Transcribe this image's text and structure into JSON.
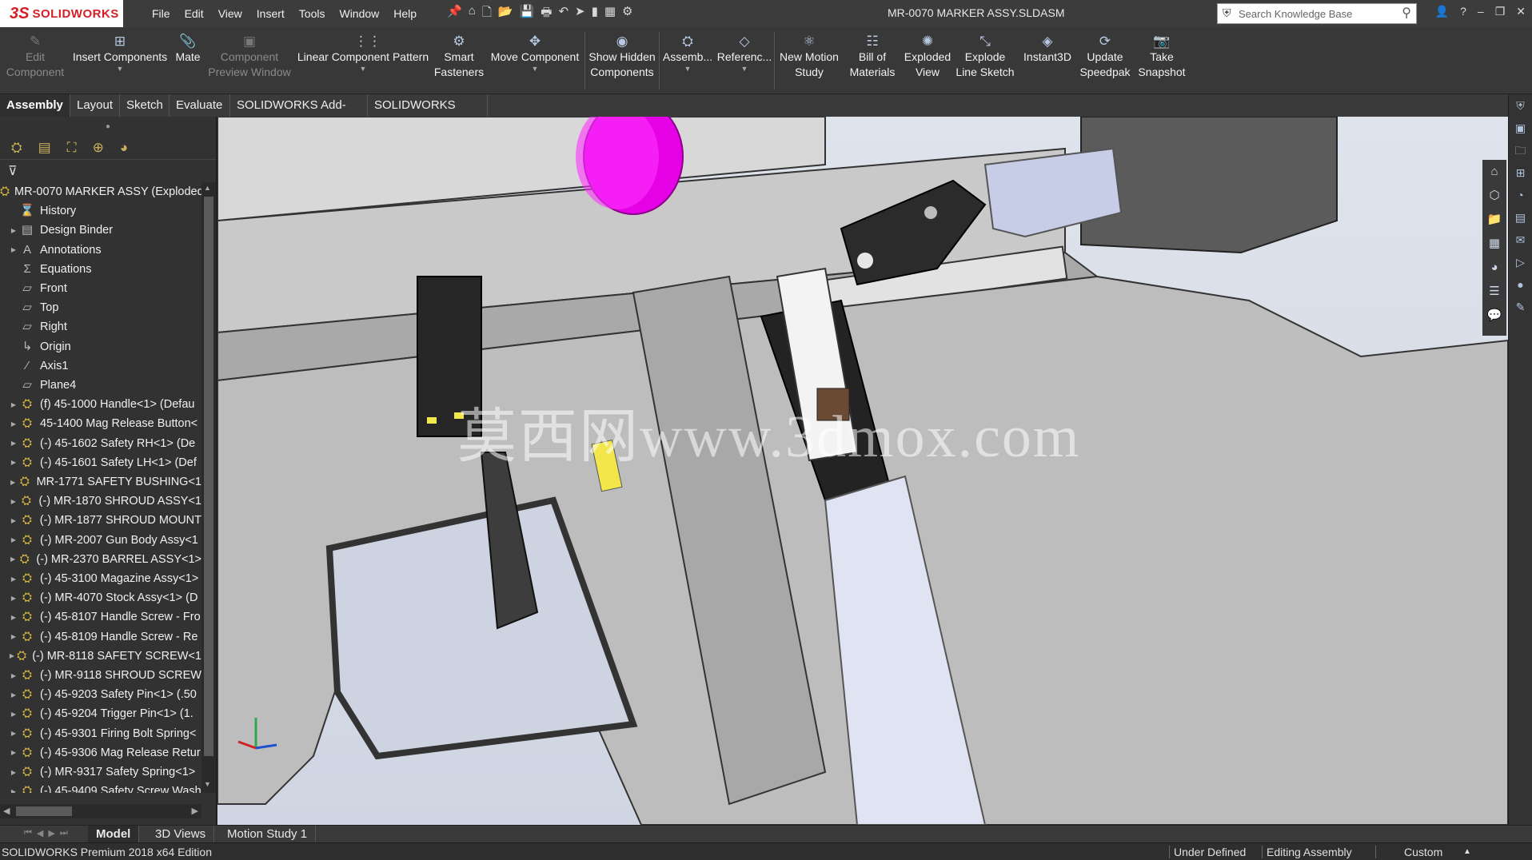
{
  "app": {
    "logo_ds": "3S",
    "logo_text": "SOLIDWORKS",
    "document_title": "MR-0070 MARKER ASSY.SLDASM"
  },
  "menu": [
    "File",
    "Edit",
    "View",
    "Insert",
    "Tools",
    "Window",
    "Help"
  ],
  "search": {
    "placeholder": "Search Knowledge Base"
  },
  "commands": [
    {
      "id": "edit-component",
      "label": "Edit Component",
      "icon": "edit-component-icon",
      "enabled": false
    },
    {
      "id": "insert-components",
      "label": "Insert Components",
      "icon": "insert-components-icon",
      "enabled": true
    },
    {
      "id": "mate",
      "label": "Mate",
      "icon": "mate-icon",
      "enabled": true
    },
    {
      "id": "component-preview-window",
      "label": "Component Preview Window",
      "icon": "preview-window-icon",
      "enabled": false
    },
    {
      "id": "linear-component-pattern",
      "label": "Linear Component Pattern",
      "icon": "linear-pattern-icon",
      "enabled": true
    },
    {
      "id": "smart-fasteners",
      "label": "Smart Fasteners",
      "icon": "smart-fasteners-icon",
      "enabled": true
    },
    {
      "id": "move-component",
      "label": "Move Component",
      "icon": "move-component-icon",
      "enabled": true
    },
    {
      "id": "show-hidden-components",
      "label": "Show Hidden Components",
      "icon": "show-hidden-icon",
      "enabled": true
    },
    {
      "id": "assembly-features",
      "label": "Assemb...",
      "icon": "assembly-features-icon",
      "enabled": true
    },
    {
      "id": "reference-geometry",
      "label": "Referenc...",
      "icon": "reference-geometry-icon",
      "enabled": true
    },
    {
      "id": "new-motion-study",
      "label": "New Motion Study",
      "icon": "motion-study-icon",
      "enabled": true
    },
    {
      "id": "bill-of-materials",
      "label": "Bill of Materials",
      "icon": "bill-of-materials-icon",
      "enabled": true
    },
    {
      "id": "exploded-view",
      "label": "Exploded View",
      "icon": "exploded-view-icon",
      "enabled": true
    },
    {
      "id": "explode-line-sketch",
      "label": "Explode Line Sketch",
      "icon": "explode-line-icon",
      "enabled": true
    },
    {
      "id": "instant3d",
      "label": "Instant3D",
      "icon": "instant3d-icon",
      "enabled": true
    },
    {
      "id": "update-speedpak",
      "label": "Update Speedpak",
      "icon": "speedpak-icon",
      "enabled": true
    },
    {
      "id": "take-snapshot",
      "label": "Take Snapshot",
      "icon": "camera-icon",
      "enabled": true
    }
  ],
  "tabs": [
    "Assembly",
    "Layout",
    "Sketch",
    "Evaluate",
    "SOLIDWORKS Add-Ins",
    "SOLIDWORKS MBD"
  ],
  "active_tab": "Assembly",
  "tree": [
    {
      "label": "MR-0070 MARKER ASSY (Exploded",
      "icon": "assembly-icon",
      "expander": false,
      "indent": 0
    },
    {
      "label": "History",
      "icon": "history-icon",
      "expander": false,
      "indent": 1
    },
    {
      "label": "Design Binder",
      "icon": "design-binder-icon",
      "expander": true,
      "indent": 1
    },
    {
      "label": "Annotations",
      "icon": "annotations-icon",
      "expander": true,
      "indent": 1
    },
    {
      "label": "Equations",
      "icon": "equations-icon",
      "expander": false,
      "indent": 1
    },
    {
      "label": "Front",
      "icon": "plane-icon",
      "expander": false,
      "indent": 1
    },
    {
      "label": "Top",
      "icon": "plane-icon",
      "expander": false,
      "indent": 1
    },
    {
      "label": "Right",
      "icon": "plane-icon",
      "expander": false,
      "indent": 1
    },
    {
      "label": "Origin",
      "icon": "origin-icon",
      "expander": false,
      "indent": 1
    },
    {
      "label": "Axis1",
      "icon": "axis-icon",
      "expander": false,
      "indent": 1
    },
    {
      "label": "Plane4",
      "icon": "plane-icon",
      "expander": false,
      "indent": 1
    },
    {
      "label": "(f) 45-1000 Handle<1> (Defau",
      "icon": "part-icon",
      "expander": true,
      "indent": 1
    },
    {
      "label": "45-1400 Mag Release Button<",
      "icon": "subassembly-icon",
      "expander": true,
      "indent": 1
    },
    {
      "label": "(-) 45-1602 Safety RH<1> (De",
      "icon": "part-icon",
      "expander": true,
      "indent": 1
    },
    {
      "label": "(-) 45-1601 Safety LH<1> (Def",
      "icon": "part-icon",
      "expander": true,
      "indent": 1
    },
    {
      "label": "MR-1771 SAFETY BUSHING<1",
      "icon": "part-icon",
      "expander": true,
      "indent": 1
    },
    {
      "label": "(-) MR-1870 SHROUD ASSY<1",
      "icon": "subassembly-icon",
      "expander": true,
      "indent": 1
    },
    {
      "label": "(-) MR-1877 SHROUD MOUNT",
      "icon": "part-icon",
      "expander": true,
      "indent": 1
    },
    {
      "label": "(-) MR-2007 Gun Body Assy<1",
      "icon": "subassembly-icon",
      "expander": true,
      "indent": 1
    },
    {
      "label": "(-) MR-2370 BARREL ASSY<1>",
      "icon": "subassembly-icon",
      "expander": true,
      "indent": 1
    },
    {
      "label": "(-) 45-3100 Magazine Assy<1>",
      "icon": "subassembly-icon",
      "expander": true,
      "indent": 1
    },
    {
      "label": "(-) MR-4070 Stock Assy<1> (D",
      "icon": "subassembly-icon",
      "expander": true,
      "indent": 1
    },
    {
      "label": "(-) 45-8107 Handle Screw - Fro",
      "icon": "part-icon",
      "expander": true,
      "indent": 1
    },
    {
      "label": "(-) 45-8109 Handle Screw - Re",
      "icon": "part-icon",
      "expander": true,
      "indent": 1
    },
    {
      "label": "(-) MR-8118 SAFETY SCREW<1",
      "icon": "part-icon",
      "expander": true,
      "indent": 1
    },
    {
      "label": "(-) MR-9118 SHROUD SCREW",
      "icon": "part-icon",
      "expander": true,
      "indent": 1
    },
    {
      "label": "(-) 45-9203 Safety Pin<1> (.50",
      "icon": "part-icon",
      "expander": true,
      "indent": 1
    },
    {
      "label": "(-) 45-9204 Trigger Pin<1> (1.",
      "icon": "part-icon",
      "expander": true,
      "indent": 1
    },
    {
      "label": "(-) 45-9301 Firing Bolt Spring<",
      "icon": "part-icon",
      "expander": true,
      "indent": 1
    },
    {
      "label": "(-) 45-9306 Mag Release Retur",
      "icon": "part-icon",
      "expander": true,
      "indent": 1
    },
    {
      "label": "(-) MR-9317 Safety Spring<1>",
      "icon": "part-icon",
      "expander": true,
      "indent": 1
    },
    {
      "label": "(-) 45-9409 Safety Screw Wash",
      "icon": "part-icon",
      "expander": true,
      "indent": 1
    }
  ],
  "watermark": "莫西网www.3dmox.com",
  "bottom_tabs": [
    "Model",
    "3D Views",
    "Motion Study 1"
  ],
  "active_bottom_tab": "Model",
  "status": {
    "edition": "SOLIDWORKS Premium 2018 x64 Edition",
    "definition": "Under Defined",
    "mode": "Editing Assembly",
    "units": "Custom"
  },
  "colors": {
    "highlight_part": "#e600e6",
    "accent_yellow": "#f2e64a",
    "logo_red": "#d41f26"
  }
}
